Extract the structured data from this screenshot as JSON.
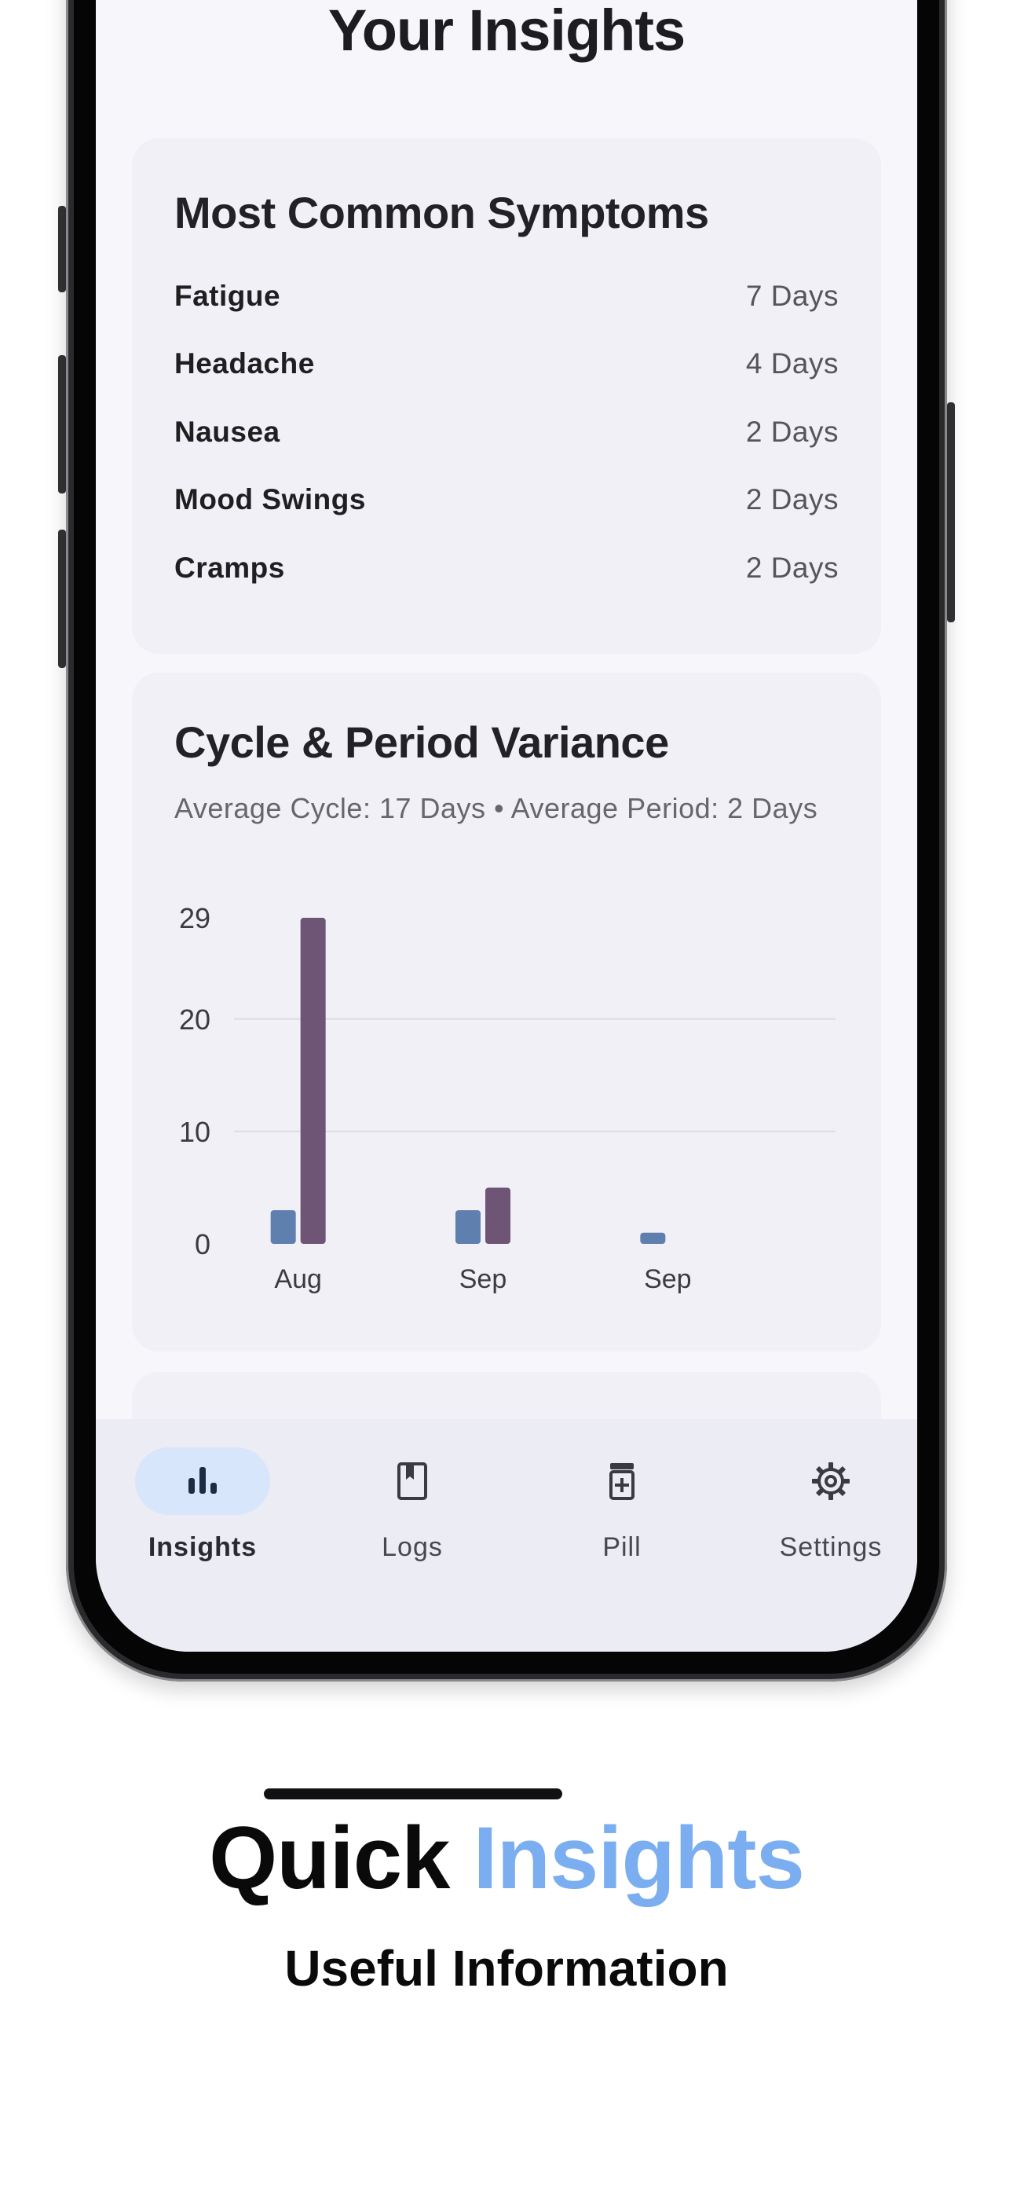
{
  "screen": {
    "title": "Your Insights"
  },
  "symptoms_card": {
    "title": "Most Common Symptoms",
    "items": [
      {
        "name": "Fatigue",
        "value": "7 Days"
      },
      {
        "name": "Headache",
        "value": "4 Days"
      },
      {
        "name": "Nausea",
        "value": "2 Days"
      },
      {
        "name": "Mood Swings",
        "value": "2 Days"
      },
      {
        "name": "Cramps",
        "value": "2 Days"
      }
    ]
  },
  "cycle_card": {
    "title": "Cycle & Period Variance",
    "subtitle": "Average Cycle: 17 Days  •  Average Period: 2 Days"
  },
  "chart_data": {
    "type": "bar",
    "categories": [
      "Aug",
      "Sep",
      "Sep"
    ],
    "series": [
      {
        "values": [
          3,
          3,
          1
        ],
        "color": "#5f7fae"
      },
      {
        "values": [
          29,
          5,
          0
        ],
        "color": "#6e5576"
      }
    ],
    "y_ticks": [
      "0",
      "10",
      "20",
      "29"
    ],
    "ylim": [
      0,
      29
    ],
    "grid": true
  },
  "tabbar": {
    "tabs": [
      {
        "label": "Insights",
        "icon": "bar-chart-icon",
        "active": true
      },
      {
        "label": "Logs",
        "icon": "book-icon",
        "active": false
      },
      {
        "label": "Pill",
        "icon": "pill-bottle-icon",
        "active": false
      },
      {
        "label": "Settings",
        "icon": "gear-icon",
        "active": false
      }
    ]
  },
  "caption": {
    "headline_primary": "Quick",
    "headline_accent": "Insights",
    "subline": "Useful Information"
  },
  "colors": {
    "accent": "#7aaef0",
    "active_tab_bg": "#d8e6fb",
    "bar_cycle": "#5f7fae",
    "bar_period": "#6e5576"
  }
}
